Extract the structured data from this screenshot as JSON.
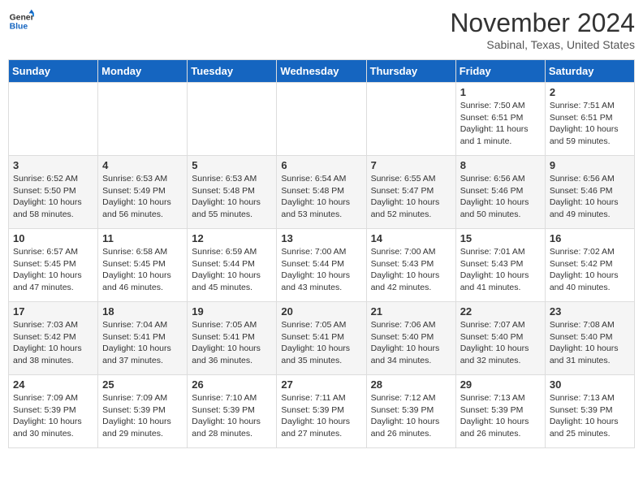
{
  "logo": {
    "line1": "General",
    "line2": "Blue"
  },
  "title": "November 2024",
  "subtitle": "Sabinal, Texas, United States",
  "days_of_week": [
    "Sunday",
    "Monday",
    "Tuesday",
    "Wednesday",
    "Thursday",
    "Friday",
    "Saturday"
  ],
  "weeks": [
    [
      {
        "day": "",
        "info": ""
      },
      {
        "day": "",
        "info": ""
      },
      {
        "day": "",
        "info": ""
      },
      {
        "day": "",
        "info": ""
      },
      {
        "day": "",
        "info": ""
      },
      {
        "day": "1",
        "info": "Sunrise: 7:50 AM\nSunset: 6:51 PM\nDaylight: 11 hours and 1 minute."
      },
      {
        "day": "2",
        "info": "Sunrise: 7:51 AM\nSunset: 6:51 PM\nDaylight: 10 hours and 59 minutes."
      }
    ],
    [
      {
        "day": "3",
        "info": "Sunrise: 6:52 AM\nSunset: 5:50 PM\nDaylight: 10 hours and 58 minutes."
      },
      {
        "day": "4",
        "info": "Sunrise: 6:53 AM\nSunset: 5:49 PM\nDaylight: 10 hours and 56 minutes."
      },
      {
        "day": "5",
        "info": "Sunrise: 6:53 AM\nSunset: 5:48 PM\nDaylight: 10 hours and 55 minutes."
      },
      {
        "day": "6",
        "info": "Sunrise: 6:54 AM\nSunset: 5:48 PM\nDaylight: 10 hours and 53 minutes."
      },
      {
        "day": "7",
        "info": "Sunrise: 6:55 AM\nSunset: 5:47 PM\nDaylight: 10 hours and 52 minutes."
      },
      {
        "day": "8",
        "info": "Sunrise: 6:56 AM\nSunset: 5:46 PM\nDaylight: 10 hours and 50 minutes."
      },
      {
        "day": "9",
        "info": "Sunrise: 6:56 AM\nSunset: 5:46 PM\nDaylight: 10 hours and 49 minutes."
      }
    ],
    [
      {
        "day": "10",
        "info": "Sunrise: 6:57 AM\nSunset: 5:45 PM\nDaylight: 10 hours and 47 minutes."
      },
      {
        "day": "11",
        "info": "Sunrise: 6:58 AM\nSunset: 5:45 PM\nDaylight: 10 hours and 46 minutes."
      },
      {
        "day": "12",
        "info": "Sunrise: 6:59 AM\nSunset: 5:44 PM\nDaylight: 10 hours and 45 minutes."
      },
      {
        "day": "13",
        "info": "Sunrise: 7:00 AM\nSunset: 5:44 PM\nDaylight: 10 hours and 43 minutes."
      },
      {
        "day": "14",
        "info": "Sunrise: 7:00 AM\nSunset: 5:43 PM\nDaylight: 10 hours and 42 minutes."
      },
      {
        "day": "15",
        "info": "Sunrise: 7:01 AM\nSunset: 5:43 PM\nDaylight: 10 hours and 41 minutes."
      },
      {
        "day": "16",
        "info": "Sunrise: 7:02 AM\nSunset: 5:42 PM\nDaylight: 10 hours and 40 minutes."
      }
    ],
    [
      {
        "day": "17",
        "info": "Sunrise: 7:03 AM\nSunset: 5:42 PM\nDaylight: 10 hours and 38 minutes."
      },
      {
        "day": "18",
        "info": "Sunrise: 7:04 AM\nSunset: 5:41 PM\nDaylight: 10 hours and 37 minutes."
      },
      {
        "day": "19",
        "info": "Sunrise: 7:05 AM\nSunset: 5:41 PM\nDaylight: 10 hours and 36 minutes."
      },
      {
        "day": "20",
        "info": "Sunrise: 7:05 AM\nSunset: 5:41 PM\nDaylight: 10 hours and 35 minutes."
      },
      {
        "day": "21",
        "info": "Sunrise: 7:06 AM\nSunset: 5:40 PM\nDaylight: 10 hours and 34 minutes."
      },
      {
        "day": "22",
        "info": "Sunrise: 7:07 AM\nSunset: 5:40 PM\nDaylight: 10 hours and 32 minutes."
      },
      {
        "day": "23",
        "info": "Sunrise: 7:08 AM\nSunset: 5:40 PM\nDaylight: 10 hours and 31 minutes."
      }
    ],
    [
      {
        "day": "24",
        "info": "Sunrise: 7:09 AM\nSunset: 5:39 PM\nDaylight: 10 hours and 30 minutes."
      },
      {
        "day": "25",
        "info": "Sunrise: 7:09 AM\nSunset: 5:39 PM\nDaylight: 10 hours and 29 minutes."
      },
      {
        "day": "26",
        "info": "Sunrise: 7:10 AM\nSunset: 5:39 PM\nDaylight: 10 hours and 28 minutes."
      },
      {
        "day": "27",
        "info": "Sunrise: 7:11 AM\nSunset: 5:39 PM\nDaylight: 10 hours and 27 minutes."
      },
      {
        "day": "28",
        "info": "Sunrise: 7:12 AM\nSunset: 5:39 PM\nDaylight: 10 hours and 26 minutes."
      },
      {
        "day": "29",
        "info": "Sunrise: 7:13 AM\nSunset: 5:39 PM\nDaylight: 10 hours and 26 minutes."
      },
      {
        "day": "30",
        "info": "Sunrise: 7:13 AM\nSunset: 5:39 PM\nDaylight: 10 hours and 25 minutes."
      }
    ]
  ]
}
